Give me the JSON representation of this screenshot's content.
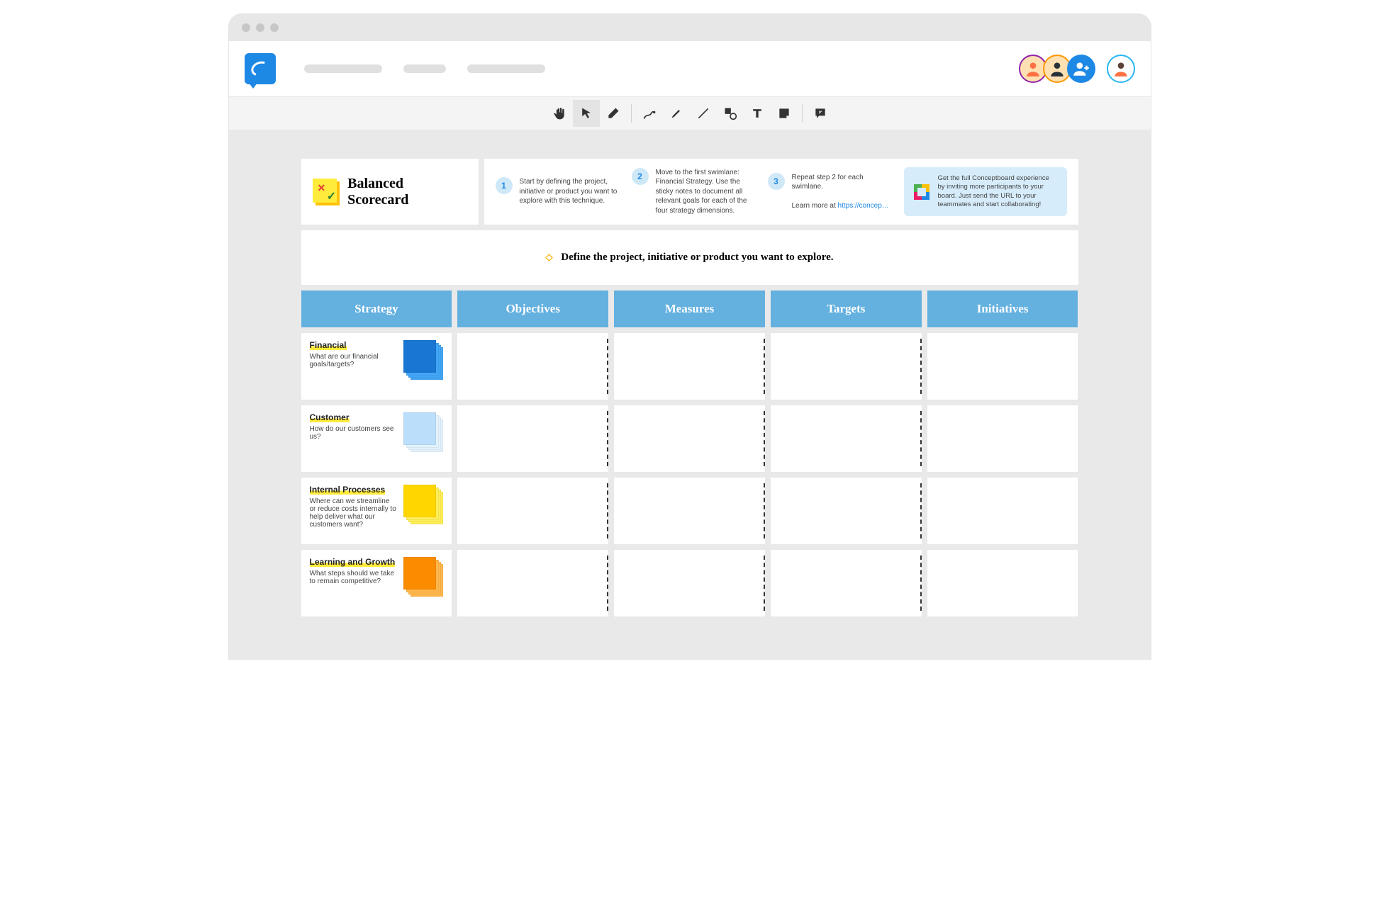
{
  "title": "Balanced Scorecard",
  "define_prompt": "Define the project, initiative or product you want to explore.",
  "steps": [
    {
      "num": "1",
      "text": "Start by defining the project, initiative or product you want to explore with this technique."
    },
    {
      "num": "2",
      "text": "Move to the first swimlane: Financial Strategy. Use the sticky notes to document all relevant goals for each of the four strategy dimensions."
    },
    {
      "num": "3",
      "text": "Repeat step 2 for each swimlane.",
      "link_prefix": "Learn more at ",
      "link": "https://concep…"
    }
  ],
  "promo": "Get the full Conceptboard experience by inviting more participants to your board. Just send the URL to your teammates and start collaborating!",
  "columns": [
    "Strategy",
    "Objectives",
    "Measures",
    "Targets",
    "Initiatives"
  ],
  "rows": [
    {
      "title": "Financial",
      "desc": "What are our financial goals/targets?",
      "color": "c-blue-d"
    },
    {
      "title": "Customer",
      "desc": "How do our customers see us?",
      "color": "c-blue-l"
    },
    {
      "title": "Internal Processes",
      "desc": "Where can we streamline or reduce costs internally to help deliver what our customers want?",
      "color": "c-yellow"
    },
    {
      "title": "Learning and Growth",
      "desc": "What steps should we take to remain competitive?",
      "color": "c-orange"
    }
  ],
  "tools": [
    "hand",
    "select",
    "eraser",
    "draw",
    "marker",
    "line",
    "shape",
    "text",
    "note",
    "comment"
  ]
}
